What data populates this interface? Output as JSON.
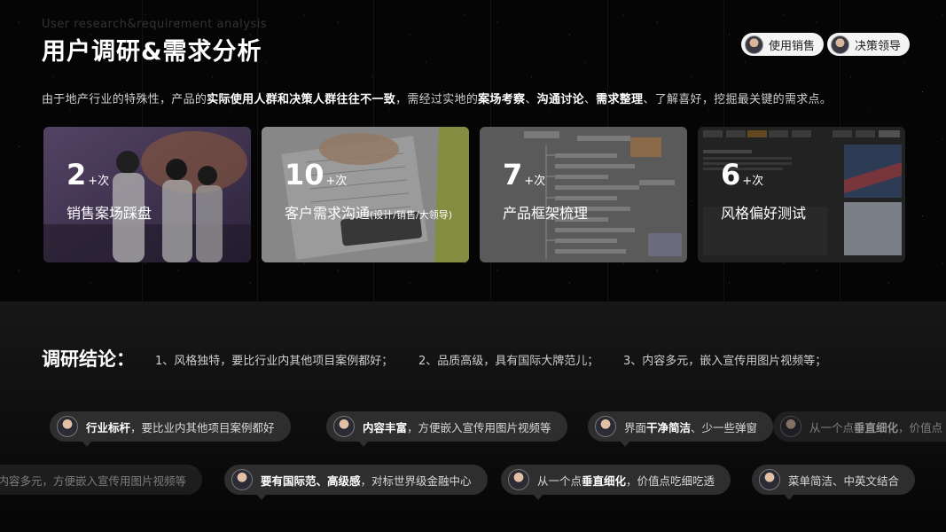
{
  "header": {
    "subtitle_en": "User research&requirement analysis",
    "title": "用户调研&需求分析"
  },
  "roles": [
    {
      "label": "使用销售"
    },
    {
      "label": "决策领导"
    }
  ],
  "intro": {
    "p1": "由于地产行业的特殊性，产品的",
    "b1": "实际使用人群和决策人群往往不一致",
    "p2": "，需经过实地的",
    "b2": "案场考察",
    "p3": "、",
    "b3": "沟通讨论",
    "p4": "、",
    "b4": "需求整理",
    "p5": "、了解喜好，挖掘最关键的需求点。"
  },
  "cards": [
    {
      "number": "2",
      "unit": "+次",
      "label": "销售案场踩盘",
      "note": ""
    },
    {
      "number": "10",
      "unit": "+次",
      "label": "客户需求沟通",
      "note": "(设计/销售/大领导)"
    },
    {
      "number": "7",
      "unit": "+次",
      "label": "产品框架梳理",
      "note": ""
    },
    {
      "number": "6",
      "unit": "+次",
      "label": "风格偏好测试",
      "note": ""
    }
  ],
  "conclusion": {
    "title": "调研结论：",
    "items": [
      "1、风格独特，要比行业内其他项目案例都好；",
      "2、品质高级，具有国际大牌范儿；",
      "3、内容多元，嵌入宣传用图片视频等；"
    ]
  },
  "bubbles_row1": [
    {
      "bold": "行业标杆",
      "text": "，要比业内其他项目案例都好",
      "pre": ""
    },
    {
      "bold": "内容丰富",
      "text": "，方便嵌入宣传用图片视频等",
      "pre": ""
    },
    {
      "pre": "界面",
      "bold": "干净简洁",
      "text": "、少一些弹窗"
    },
    {
      "pre": "从一个点",
      "bold": "垂直细化",
      "text": "，价值点"
    }
  ],
  "bubbles_row2": [
    {
      "pre": "内容多元，方便嵌入宣传用图片视频等",
      "bold": "",
      "text": ""
    },
    {
      "pre": "",
      "bold": "要有国际范、高级感",
      "text": "，对标世界级金融中心"
    },
    {
      "pre": "从一个点",
      "bold": "垂直细化",
      "text": "，价值点吃细吃透"
    },
    {
      "pre": "菜单简洁、中英文结合",
      "bold": "",
      "text": ""
    }
  ]
}
